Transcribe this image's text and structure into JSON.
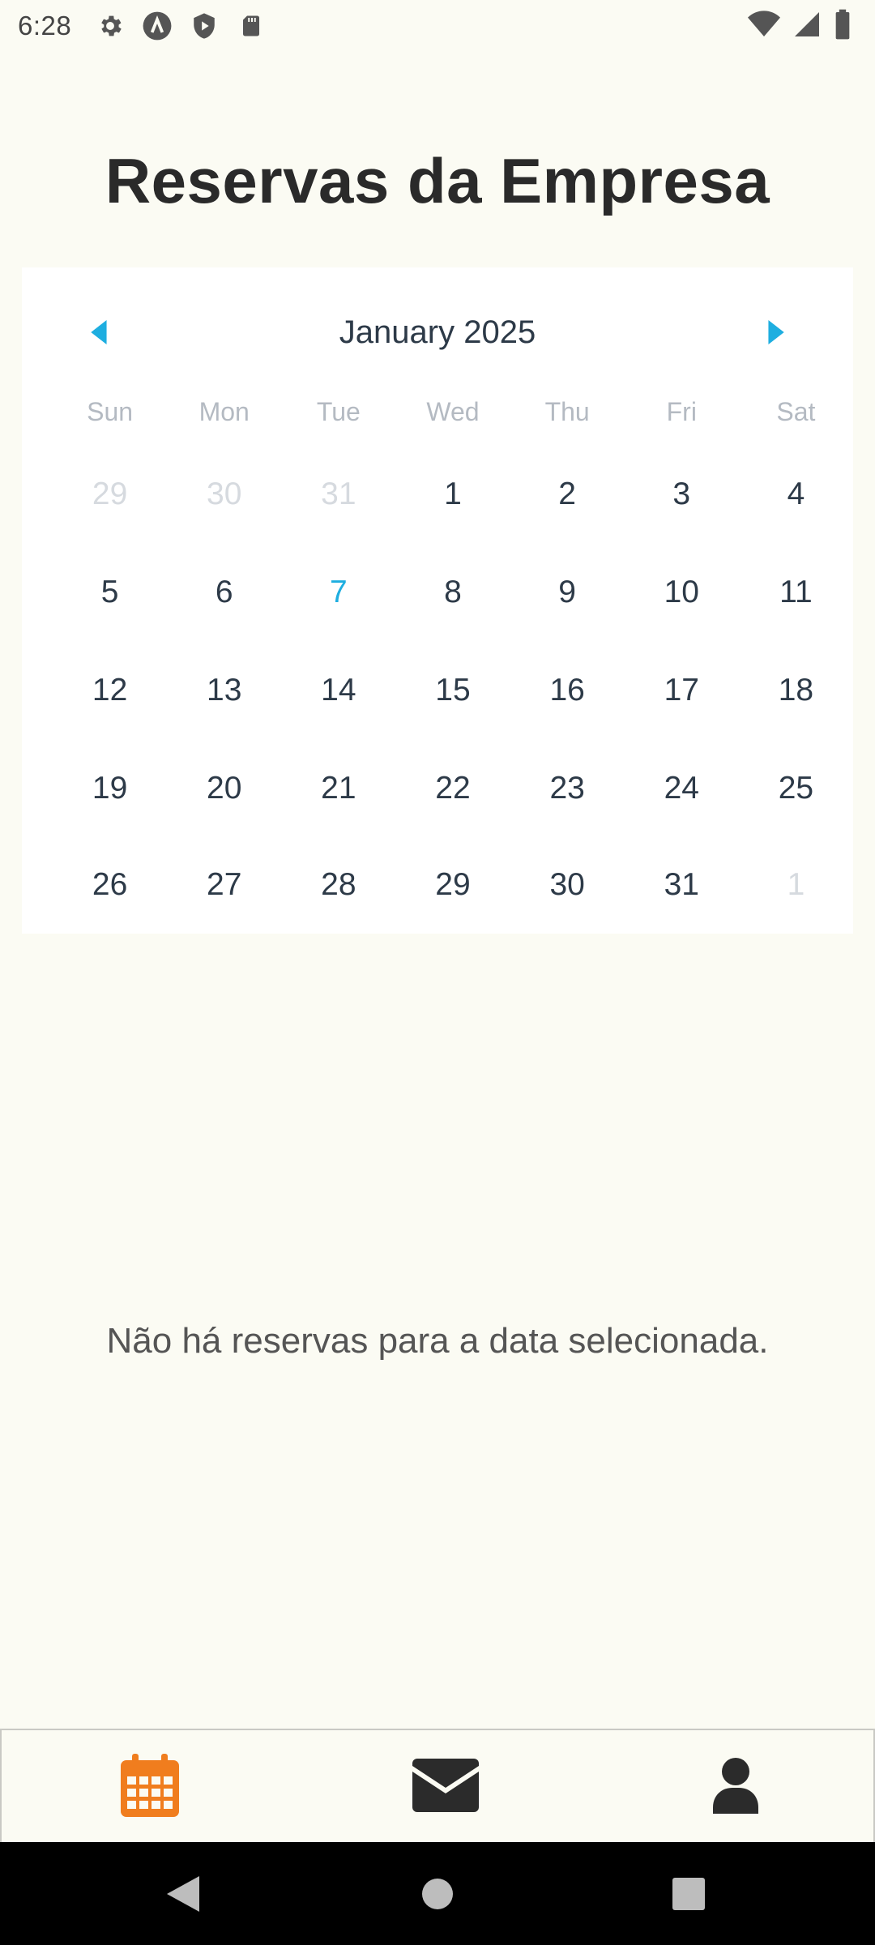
{
  "status_bar": {
    "time": "6:28",
    "left_icons": [
      "settings-icon",
      "app-a-icon",
      "shield-play-icon",
      "sd-card-icon"
    ],
    "right_icons": [
      "wifi-icon",
      "signal-icon",
      "battery-icon"
    ]
  },
  "page": {
    "title": "Reservas da Empresa"
  },
  "calendar": {
    "month_label": "January 2025",
    "weekdays": [
      "Sun",
      "Mon",
      "Tue",
      "Wed",
      "Thu",
      "Fri",
      "Sat"
    ],
    "weeks": [
      [
        "29",
        "30",
        "31",
        "1",
        "2",
        "3",
        "4"
      ],
      [
        "5",
        "6",
        "7",
        "8",
        "9",
        "10",
        "11"
      ],
      [
        "12",
        "13",
        "14",
        "15",
        "16",
        "17",
        "18"
      ],
      [
        "19",
        "20",
        "21",
        "22",
        "23",
        "24",
        "25"
      ],
      [
        "26",
        "27",
        "28",
        "29",
        "30",
        "31",
        "1"
      ]
    ],
    "today": "7",
    "accent_color": "#1eaee0"
  },
  "empty_state": {
    "message": "Não há reservas para a data selecionada."
  },
  "tab_bar": {
    "tabs": [
      {
        "icon": "calendar-icon",
        "active": true,
        "color": "#f07d1e"
      },
      {
        "icon": "envelope-icon",
        "active": false,
        "color": "#2b2b2b"
      },
      {
        "icon": "user-icon",
        "active": false,
        "color": "#2b2b2b"
      }
    ]
  },
  "nav_bar": {
    "buttons": [
      "back-icon",
      "home-icon",
      "recents-icon"
    ]
  }
}
